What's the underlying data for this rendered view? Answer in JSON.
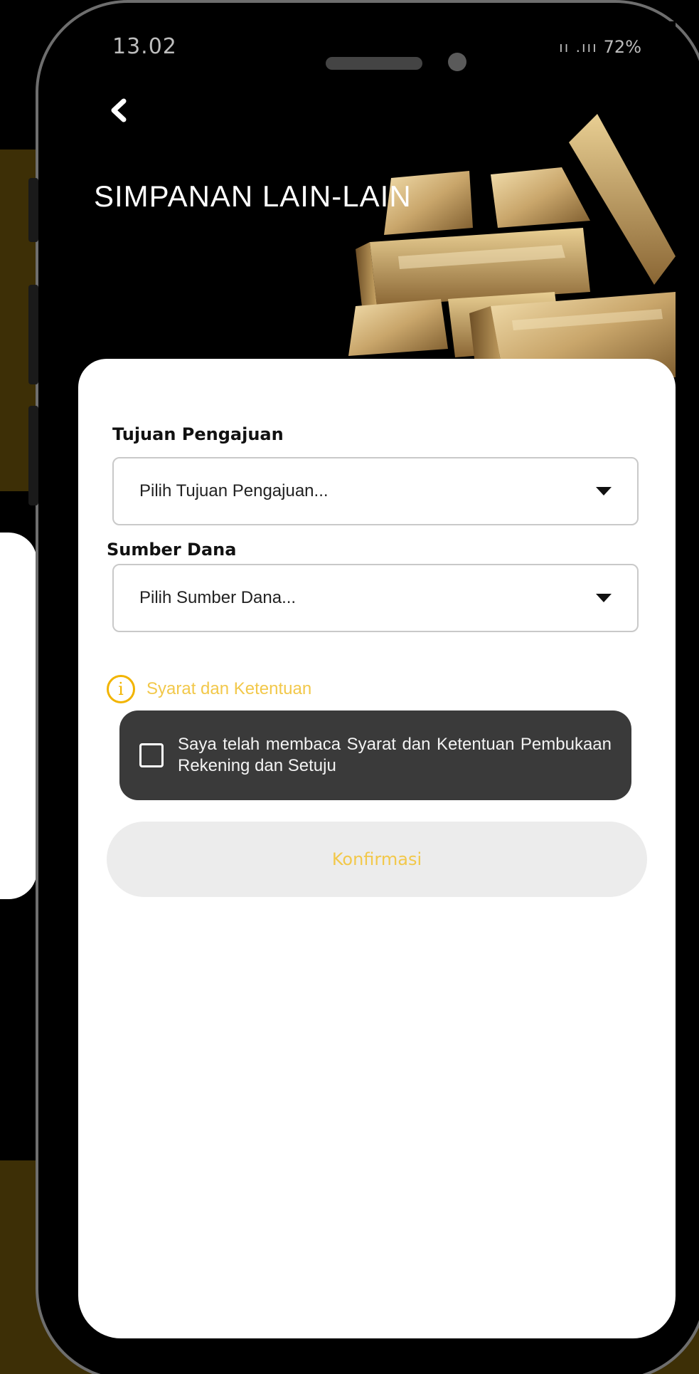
{
  "status_bar": {
    "time": "13.02",
    "signal": "ıı .ııı",
    "battery": "72%"
  },
  "header": {
    "title": "SIMPANAN LAIN-LAIN",
    "back_icon": "chevron-left-icon"
  },
  "form": {
    "purpose": {
      "label": "Tujuan Pengajuan",
      "placeholder": "Pilih Tujuan Pengajuan..."
    },
    "fund_source": {
      "label": "Sumber Dana",
      "placeholder": "Pilih Sumber Dana..."
    },
    "terms": {
      "link_text": "Syarat dan Ketentuan",
      "info_glyph": "i",
      "agree_text": "Saya telah membaca Syarat dan Ketentuan Pembukaan Rekening dan Setuju",
      "checked": false
    },
    "confirm_label": "Konfirmasi"
  },
  "colors": {
    "accent": "#f2c84a",
    "dark_box": "#3a3a3a",
    "button_bg": "#ececec"
  }
}
